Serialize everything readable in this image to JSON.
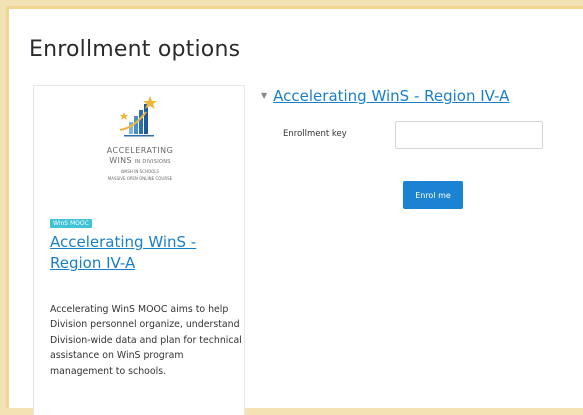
{
  "page": {
    "title": "Enrollment options"
  },
  "course_card": {
    "logo": {
      "line1": "ACCELERATING",
      "line2_main": "WINS",
      "line2_small": "IN DIVISIONS",
      "line3": "WASH IN SCHOOLS",
      "line4": "MASSIVE OPEN ONLINE COURSE",
      "icon": "bar-chart-star-logo"
    },
    "badge": "WinS MOOC",
    "course_name": "Accelerating WinS - Region IV-A",
    "summary": "Accelerating WinS MOOC aims to help Division personnel organize, understand Division-wide data and plan for technical assistance on WinS program management to schools."
  },
  "enrolment": {
    "section_title": "Accelerating WinS - Region IV-A",
    "key_label": "Enrollment key",
    "key_value": "",
    "button_label": "Enrol me"
  },
  "colors": {
    "link": "#1a7fc8",
    "button": "#1c83d2",
    "badge": "#3fc3d6",
    "frame_border": "#efd693"
  }
}
